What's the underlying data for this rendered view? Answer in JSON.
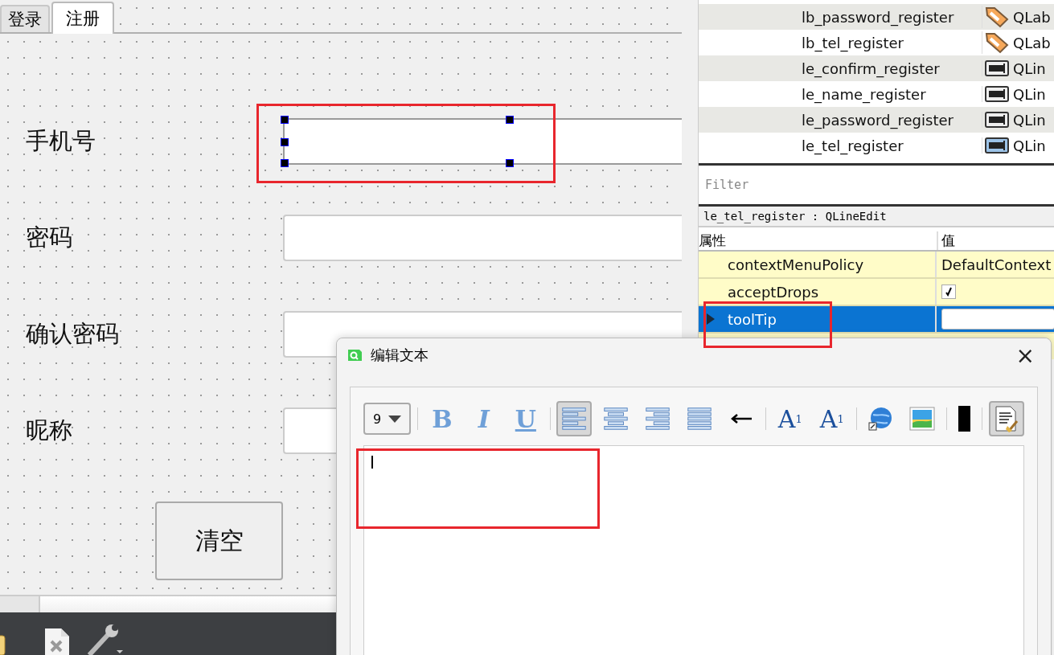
{
  "form": {
    "tabs": [
      {
        "label": "登录",
        "selected": false
      },
      {
        "label": "注册",
        "selected": true
      }
    ],
    "fields": [
      {
        "label": "手机号",
        "selected": true,
        "highlighted": true
      },
      {
        "label": "密码",
        "selected": false,
        "highlighted": false
      },
      {
        "label": "确认密码",
        "selected": false,
        "highlighted": false
      },
      {
        "label": "昵称",
        "selected": false,
        "highlighted": false
      }
    ],
    "button": "清空"
  },
  "objects": [
    {
      "name": "lb_password_register",
      "kind": "label",
      "class": "QLab",
      "selected": false
    },
    {
      "name": "lb_tel_register",
      "kind": "label",
      "class": "QLab",
      "selected": false
    },
    {
      "name": "le_confirm_register",
      "kind": "lineedit",
      "class": "QLin",
      "selected": false
    },
    {
      "name": "le_name_register",
      "kind": "lineedit",
      "class": "QLin",
      "selected": false
    },
    {
      "name": "le_password_register",
      "kind": "lineedit",
      "class": "QLin",
      "selected": false
    },
    {
      "name": "le_tel_register",
      "kind": "lineedit",
      "class": "QLin",
      "selected": true
    }
  ],
  "filter": {
    "placeholder": "Filter"
  },
  "current_object": "le_tel_register : QLineEdit",
  "properties": {
    "columns": [
      "属性",
      "值"
    ],
    "rows": [
      {
        "name": "contextMenuPolicy",
        "kind": "text",
        "value": "DefaultContext",
        "selected": false,
        "highlighted": false
      },
      {
        "name": "acceptDrops",
        "kind": "checkbox",
        "checked": true,
        "selected": false,
        "highlighted": false
      },
      {
        "name": "toolTip",
        "kind": "field",
        "selected": true,
        "expanded": false,
        "highlighted": true
      }
    ]
  },
  "dialog": {
    "title": "编辑文本",
    "close": "×",
    "toolbar": [
      {
        "kind": "combo",
        "value": "9"
      },
      {
        "kind": "sep"
      },
      {
        "kind": "bold",
        "glyph": "B",
        "selected": false
      },
      {
        "kind": "italic",
        "glyph": "I",
        "selected": false
      },
      {
        "kind": "underline",
        "glyph": "U",
        "selected": false
      },
      {
        "kind": "sep"
      },
      {
        "kind": "align-left",
        "selected": true
      },
      {
        "kind": "align-center",
        "selected": false
      },
      {
        "kind": "align-right",
        "selected": false
      },
      {
        "kind": "justify",
        "selected": false
      },
      {
        "kind": "direction",
        "selected": false
      },
      {
        "kind": "sep"
      },
      {
        "kind": "superscript",
        "glyph": "A",
        "mark": "1",
        "selected": false
      },
      {
        "kind": "subscript",
        "glyph": "A",
        "mark": "1",
        "selected": false
      },
      {
        "kind": "sep"
      },
      {
        "kind": "link",
        "selected": false
      },
      {
        "kind": "image",
        "selected": false
      },
      {
        "kind": "sep"
      },
      {
        "kind": "color",
        "color": "#000000"
      },
      {
        "kind": "sep"
      },
      {
        "kind": "source",
        "selected": true
      }
    ],
    "editor": {
      "highlighted": true
    }
  }
}
